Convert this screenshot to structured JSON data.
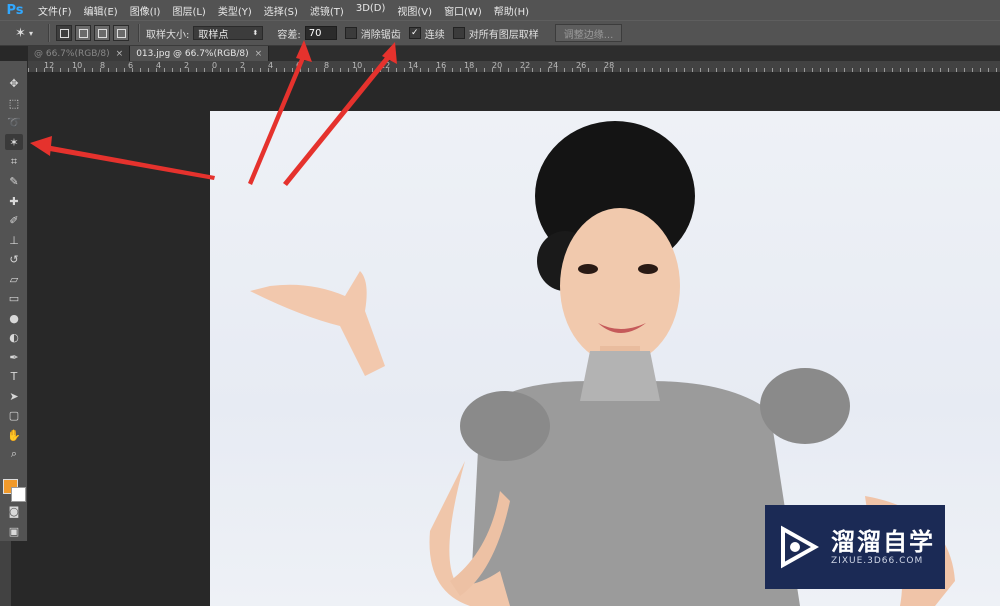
{
  "app": {
    "logo": "Ps"
  },
  "menu": [
    "文件(F)",
    "编辑(E)",
    "图像(I)",
    "图层(L)",
    "类型(Y)",
    "选择(S)",
    "滤镜(T)",
    "3D(D)",
    "视图(V)",
    "窗口(W)",
    "帮助(H)"
  ],
  "options": {
    "sample_size_label": "取样大小:",
    "sample_size_value": "取样点",
    "tolerance_label": "容差:",
    "tolerance_value": "70",
    "antialias_label": "消除锯齿",
    "contiguous_label": "连续",
    "contiguous_checked": true,
    "all_layers_label": "对所有图层取样",
    "refine_edge_label": "调整边缘..."
  },
  "tabs": [
    {
      "label": "@ 66.7%(RGB/8)",
      "close": "×",
      "active": false
    },
    {
      "label": "013.jpg @ 66.7%(RGB/8)",
      "close": "×",
      "active": true
    }
  ],
  "ruler": {
    "h_labels": [
      "12",
      "10",
      "8",
      "6",
      "4",
      "2",
      "0",
      "2",
      "4",
      "6",
      "8",
      "10",
      "12",
      "14",
      "16",
      "18",
      "20",
      "22",
      "24",
      "26",
      "28"
    ]
  },
  "colors": {
    "foreground": "#f19a2b",
    "background": "#ffffff",
    "arrow": "#e5322d",
    "watermark_bg": "#1b2a55"
  },
  "watermark": {
    "title": "溜溜自学",
    "url": "ZIXUE.3D66.COM"
  }
}
